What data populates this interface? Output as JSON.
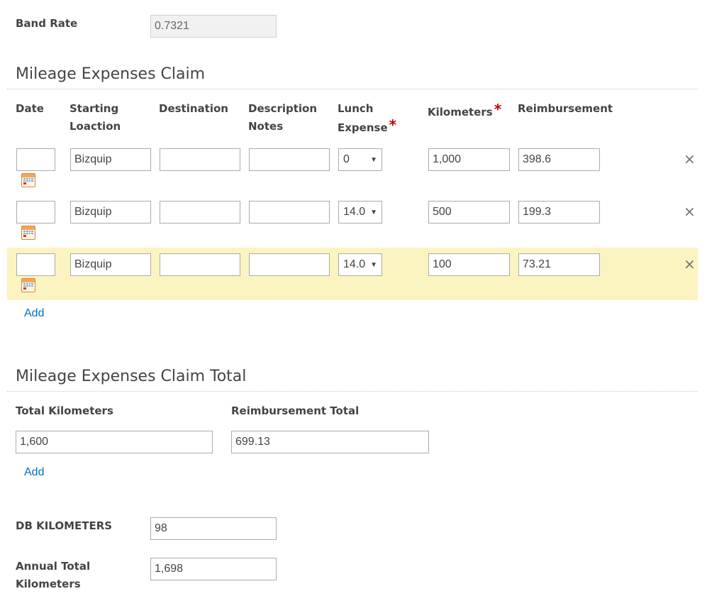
{
  "band_rate": {
    "label": "Band Rate",
    "value": "0.7321"
  },
  "mileage_claim": {
    "title": "Mileage Expenses Claim",
    "columns": {
      "date": "Date",
      "start_l1": "Starting",
      "start_l2": "Loaction",
      "destination": "Destination",
      "desc_l1": "Description",
      "desc_l2": "Notes",
      "lunch_l1": "Lunch",
      "lunch_l2": "Expense",
      "kilometers": "Kilometers",
      "reimbursement": "Reimbursement",
      "required_marker": "*"
    },
    "rows": [
      {
        "date": "",
        "starting_location": "Bizquip",
        "destination": "",
        "notes": "",
        "lunch_expense": "0",
        "kilometers": "1,000",
        "reimbursement": "398.6",
        "remove_icon": "×"
      },
      {
        "date": "",
        "starting_location": "Bizquip",
        "destination": "",
        "notes": "",
        "lunch_expense": "14.0",
        "kilometers": "500",
        "reimbursement": "199.3",
        "remove_icon": "×"
      },
      {
        "date": "",
        "starting_location": "Bizquip",
        "destination": "",
        "notes": "",
        "lunch_expense": "14.0",
        "kilometers": "100",
        "reimbursement": "73.21",
        "remove_icon": "×"
      }
    ],
    "add_label": "Add",
    "highlight_color": "#fcf4c0"
  },
  "claim_total": {
    "title": "Mileage Expenses Claim Total",
    "total_km_label": "Total Kilometers",
    "total_km_value": "1,600",
    "reimb_total_label": "Reimbursement Total",
    "reimb_total_value": "699.13",
    "add_label": "Add"
  },
  "db_kilometers": {
    "label": "DB KILOMETERS",
    "value": "98"
  },
  "annual_total": {
    "label_l1": "Annual Total",
    "label_l2": "Kilometers",
    "value": "1,698"
  },
  "colors": {
    "link": "#0072c6",
    "required": "#bf0000",
    "text": "#444444"
  }
}
